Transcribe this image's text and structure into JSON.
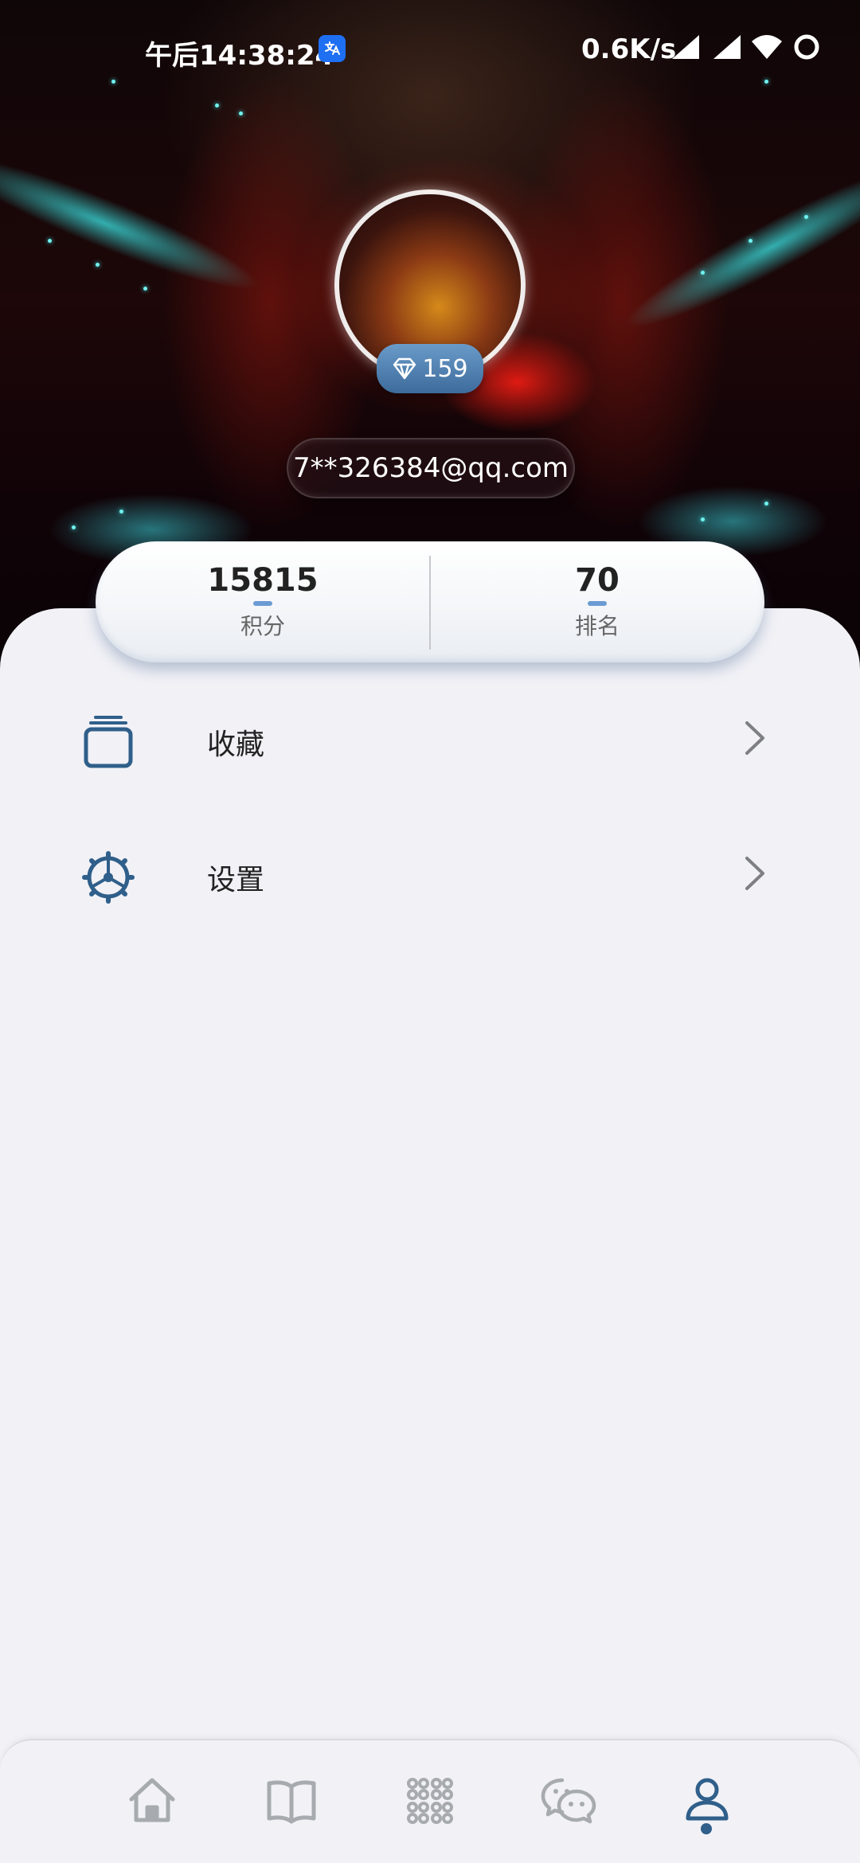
{
  "status_bar": {
    "time": "午后14:38:24",
    "net_speed": "0.6K/s",
    "app_icon": "translate-icon",
    "signal_icons": [
      "cell-signal-icon",
      "cell-signal-icon"
    ],
    "wifi_icon": "wifi-icon",
    "battery_icon": "battery-ring-icon"
  },
  "profile": {
    "level": "159",
    "level_icon": "diamond-icon",
    "email": "7**326384@qq.com"
  },
  "stats": [
    {
      "value": "15815",
      "label": "积分"
    },
    {
      "value": "70",
      "label": "排名"
    }
  ],
  "menu": [
    {
      "label": "收藏",
      "icon": "collection-stack-icon"
    },
    {
      "label": "设置",
      "icon": "settings-gear-icon"
    }
  ],
  "bottom_nav": {
    "items": [
      {
        "icon": "home-icon",
        "active": false
      },
      {
        "icon": "book-icon",
        "active": false
      },
      {
        "icon": "apps-grid-icon",
        "active": false
      },
      {
        "icon": "wechat-icon",
        "active": false
      },
      {
        "icon": "profile-icon",
        "active": true
      }
    ],
    "active_color": "#2f5f8a",
    "inactive_color": "#a7aaae"
  },
  "colors": {
    "accent": "#2f5f8a",
    "stat_bar": "#6c9bd3",
    "page_bg": "#f1f1f6"
  }
}
